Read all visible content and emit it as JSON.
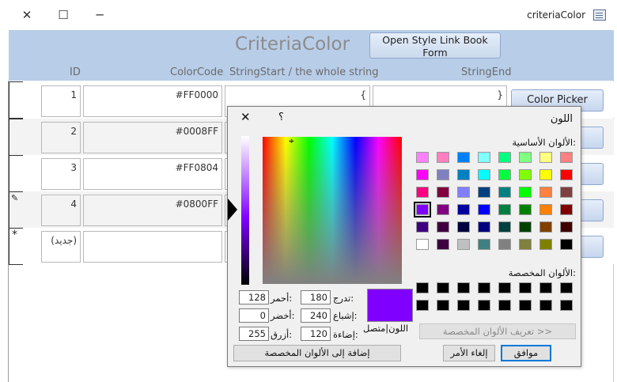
{
  "window": {
    "title": "criteriaColor",
    "icons": [
      "close-icon",
      "maximize-icon",
      "minimize-icon",
      "form-app-icon"
    ]
  },
  "form": {
    "title": "CriteriaColor",
    "open_style_button": "Open Style Link  Book Form",
    "columns": {
      "id": "ID",
      "color_code": "ColorCode",
      "string_start": "StringStart / the whole string",
      "string_end": "StringEnd"
    },
    "rows": [
      {
        "id": "1",
        "color_code": "#FF0000",
        "string_start": "{",
        "string_end": "}"
      },
      {
        "id": "2",
        "color_code": "#0008FF",
        "string_start": "",
        "string_end": ""
      },
      {
        "id": "3",
        "color_code": "#FF0804",
        "string_start": "",
        "string_end": ""
      },
      {
        "id": "4",
        "color_code": "#0800FF",
        "string_start": "",
        "string_end": ""
      }
    ],
    "new_row_label": "(جديد)",
    "new_record_marker": "*",
    "edit_marker_icon": "pencil-icon",
    "color_picker_button": "Color Picker"
  },
  "color_dialog": {
    "title": "اللون",
    "help": "؟",
    "basic_colors_label": "الألوان الأساسية:",
    "custom_colors_label": "الألوان المخصصة:",
    "basic_colors": [
      [
        "#ff8080",
        "#ffff80",
        "#80ff80",
        "#00ff80",
        "#80ffff",
        "#0080ff",
        "#ff80c0",
        "#ff80ff"
      ],
      [
        "#ff0000",
        "#ffff00",
        "#80ff00",
        "#00ff40",
        "#00ffff",
        "#0080c0",
        "#8080c0",
        "#ff00ff"
      ],
      [
        "#804040",
        "#ff8040",
        "#00ff00",
        "#008080",
        "#004080",
        "#8080ff",
        "#800040",
        "#ff0080"
      ],
      [
        "#800000",
        "#ff8000",
        "#008000",
        "#008040",
        "#0000ff",
        "#0000a0",
        "#800080",
        "#8000ff"
      ],
      [
        "#400000",
        "#804000",
        "#004000",
        "#004040",
        "#000080",
        "#000040",
        "#400040",
        "#400080"
      ],
      [
        "#000000",
        "#808000",
        "#808040",
        "#808080",
        "#408080",
        "#c0c0c0",
        "#400040",
        "#ffffff"
      ]
    ],
    "selected_basic": "#8000ff",
    "custom_colors": [
      [
        "#000000",
        "#000000",
        "#000000",
        "#000000",
        "#000000",
        "#000000",
        "#000000",
        "#000000"
      ],
      [
        "#000000",
        "#000000",
        "#000000",
        "#000000",
        "#000000",
        "#000000",
        "#000000",
        "#000000"
      ]
    ],
    "define_custom_button": "تعريف الألوان المخصصة >>",
    "ok_button": "موافق",
    "cancel_button": "إلغاء الأمر",
    "add_custom_button": "إضافة إلى الألوان المخصصة",
    "preview_label": "اللون|متصل",
    "preview_color": "#8000ff",
    "hue_label": "تدرج:",
    "hue": "180",
    "sat_label": "إشباع:",
    "sat": "240",
    "lum_label": "إضاءة:",
    "lum": "120",
    "red_label": "أحمر:",
    "red": "128",
    "green_label": "أخضر:",
    "green": "0",
    "blue_label": "أزرق:",
    "blue": "255"
  }
}
